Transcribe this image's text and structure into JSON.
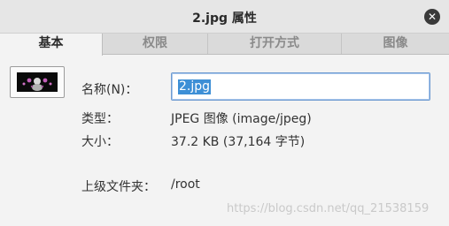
{
  "window": {
    "title": "2.jpg 属性",
    "close_symbol": "✕"
  },
  "tabs": [
    {
      "label": "基本",
      "active": true
    },
    {
      "label": "权限",
      "active": false
    },
    {
      "label": "打开方式",
      "active": false
    },
    {
      "label": "图像",
      "active": false
    }
  ],
  "fields": {
    "name_label": "名称(N)：",
    "name_value": "2.jpg",
    "type_label": "类型：",
    "type_value": "JPEG 图像 (image/jpeg)",
    "size_label": "大小：",
    "size_value": "37.2 KB (37,164 字节)",
    "parent_label": "上级文件夹：",
    "parent_value": "/root"
  },
  "watermark": "https://blog.csdn.net/qq_21538159",
  "colors": {
    "selection": "#3d8fd6",
    "input_border": "#6e9bd1",
    "close_button": "#3a3a3a"
  }
}
